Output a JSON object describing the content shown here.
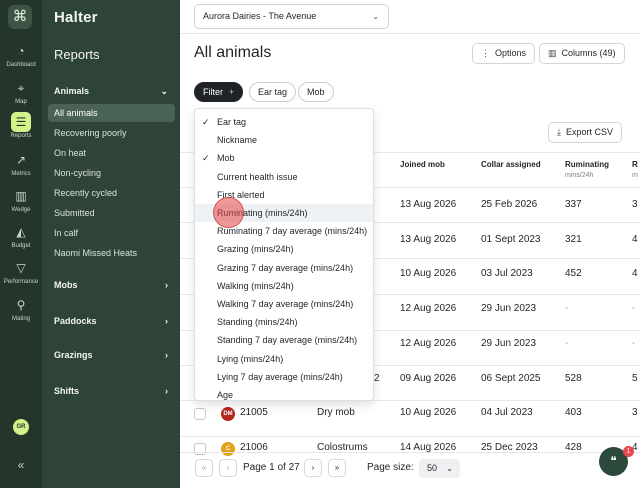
{
  "rail": {
    "logo_glyph": "⌘",
    "items": [
      {
        "label": "Dashboard",
        "glyph": "◔",
        "icon": "speedometer-icon"
      },
      {
        "label": "Map",
        "glyph": "⌖",
        "icon": "map-pin-icon"
      },
      {
        "label": "Reports",
        "glyph": "☰",
        "icon": "reports-list-icon",
        "active": true
      },
      {
        "label": "Metrics",
        "glyph": "↗",
        "icon": "line-chart-icon"
      },
      {
        "label": "Wedge",
        "glyph": "▥",
        "icon": "bar-chart-icon"
      },
      {
        "label": "Budget",
        "glyph": "◭",
        "icon": "budget-icon"
      },
      {
        "label": "Performance",
        "glyph": "▽",
        "icon": "performance-icon"
      },
      {
        "label": "Mating",
        "glyph": "⚲",
        "icon": "mating-search-icon"
      }
    ],
    "avatar_initials": "GR",
    "collapse_glyph": "«"
  },
  "nav": {
    "brand": "Halter",
    "title": "Reports",
    "animals_group": "Animals",
    "animals_links": [
      "All animals",
      "Recovering poorly",
      "On heat",
      "Non-cycling",
      "Recently cycled",
      "Submitted",
      "In calf",
      "Naomi Missed Heats"
    ],
    "other_groups": [
      "Mobs",
      "Paddocks",
      "Grazings",
      "Shifts"
    ],
    "chevron_down": "⌄",
    "chevron_right": "›"
  },
  "header": {
    "farm": "Aurora Dairies - The Avenue",
    "select_chevron": "⌄",
    "page_title": "All animals",
    "options_label": "Options",
    "options_glyph": "⋮",
    "columns_label": "Columns (49)",
    "columns_glyph": "▥",
    "export_label": "Export CSV",
    "export_glyph": "⤓"
  },
  "filters": {
    "filter_label": "Filter",
    "filter_plus": "+",
    "chips": [
      "Ear tag",
      "Mob"
    ]
  },
  "table": {
    "columns": [
      {
        "label": "Joined mob",
        "sub": ""
      },
      {
        "label": "Collar assigned",
        "sub": ""
      },
      {
        "label": "Ruminating",
        "sub": "mins/24h"
      },
      {
        "label": "R",
        "sub": "m"
      }
    ],
    "rows": [
      {
        "joined": "13 Aug 2026",
        "collar": "25 Feb 2026",
        "rum": "337",
        "next": "3"
      },
      {
        "joined": "13 Aug 2026",
        "collar": "01 Sept 2023",
        "rum": "321",
        "next": "4"
      },
      {
        "joined": "10 Aug 2026",
        "collar": "03 Jul 2023",
        "rum": "452",
        "next": "4"
      },
      {
        "joined": "12 Aug 2026",
        "collar": "29 Jun 2023",
        "rum": "-",
        "next": "-"
      },
      {
        "joined": "12 Aug 2026",
        "collar": "29 Jun 2023",
        "rum": "-",
        "next": "-"
      },
      {
        "mob_tail": "2",
        "joined": "09 Aug 2026",
        "collar": "06 Sept 2025",
        "rum": "528",
        "next": "5"
      },
      {
        "badge": "DM",
        "badge_color": "#b3261e",
        "tag": "21005",
        "mob": "Dry mob",
        "joined": "10 Aug 2026",
        "collar": "04 Jul 2023",
        "rum": "403",
        "next": "3"
      },
      {
        "badge": "C",
        "badge_color": "#e3a21a",
        "tag": "21006",
        "mob": "Colostrums",
        "joined": "14 Aug 2026",
        "collar": "25 Dec 2023",
        "rum": "428",
        "next": "4"
      }
    ]
  },
  "dropdown": {
    "check_glyph": "✓",
    "items": [
      {
        "label": "Ear tag",
        "checked": true
      },
      {
        "label": "Nickname",
        "checked": false
      },
      {
        "label": "Mob",
        "checked": true
      },
      {
        "label": "Current health issue",
        "checked": false
      },
      {
        "label": "First alerted",
        "checked": false
      },
      {
        "label": "Ruminating (mins/24h)",
        "checked": false,
        "hover": true
      },
      {
        "label": "Ruminating 7 day average (mins/24h)",
        "checked": false
      },
      {
        "label": "Grazing (mins/24h)",
        "checked": false
      },
      {
        "label": "Grazing 7 day average (mins/24h)",
        "checked": false
      },
      {
        "label": "Walking (mins/24h)",
        "checked": false
      },
      {
        "label": "Walking 7 day average (mins/24h)",
        "checked": false
      },
      {
        "label": "Standing (mins/24h)",
        "checked": false
      },
      {
        "label": "Standing 7 day average (mins/24h)",
        "checked": false
      },
      {
        "label": "Lying (mins/24h)",
        "checked": false
      },
      {
        "label": "Lying 7 day average (mins/24h)",
        "checked": false
      },
      {
        "label": "Age",
        "checked": false
      }
    ]
  },
  "pagination": {
    "first": "«",
    "prev": "‹",
    "page_text": "Page 1 of 27",
    "next": "›",
    "last": "»",
    "size_label": "Page size:",
    "size_value": "50",
    "size_chevron": "⌄"
  },
  "chat": {
    "glyph": "❝",
    "badge": "1"
  },
  "colors": {
    "rail": "#24352c",
    "nav": "#2e4437",
    "accent": "#d2f38a"
  }
}
